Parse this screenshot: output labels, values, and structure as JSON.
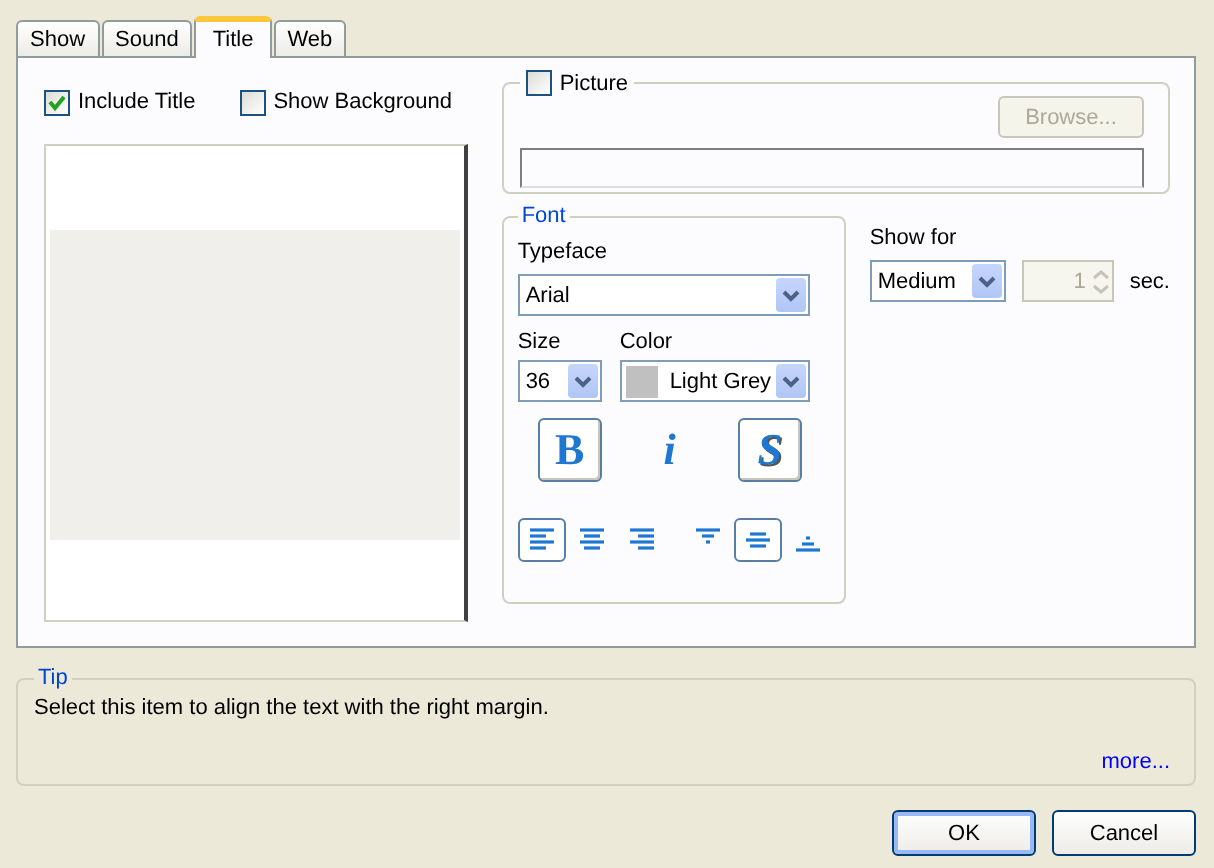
{
  "tabs": [
    {
      "label": "Show",
      "selected": false
    },
    {
      "label": "Sound",
      "selected": false
    },
    {
      "label": "Title",
      "selected": true
    },
    {
      "label": "Web",
      "selected": false
    }
  ],
  "include_title": {
    "label": "Include Title",
    "checked": true
  },
  "show_background": {
    "label": "Show Background",
    "checked": false
  },
  "picture": {
    "label": "Picture",
    "checked": false,
    "browse_button": {
      "label": "Browse...",
      "disabled": true
    }
  },
  "font": {
    "title": "Font",
    "typeface": {
      "label": "Typeface",
      "value": "Arial"
    },
    "size": {
      "label": "Size",
      "value": "36"
    },
    "color": {
      "label": "Color",
      "value": "Light Grey",
      "color": "#c0c0c0"
    },
    "style_buttons": [
      {
        "kind": "bold",
        "label": "B",
        "selected": true
      },
      {
        "kind": "italic",
        "label": "i",
        "selected": false
      },
      {
        "kind": "shadow",
        "label": "S",
        "selected": true
      }
    ],
    "align_buttons": [
      {
        "kind": "left",
        "selected": true
      },
      {
        "kind": "center",
        "selected": false
      },
      {
        "kind": "right",
        "selected": false
      },
      {
        "kind": "top",
        "selected": false
      },
      {
        "kind": "middle",
        "selected": true
      },
      {
        "kind": "bottom",
        "selected": false
      }
    ]
  },
  "show_for": {
    "label": "Show for",
    "value": "Medium",
    "seconds": {
      "value": "1",
      "disabled": true
    },
    "unit": "sec."
  },
  "tip": {
    "title": "Tip",
    "text": "Select this item to align the text with the right margin.",
    "link": "more..."
  },
  "buttons": [
    {
      "label": "OK",
      "default": true
    },
    {
      "label": "Cancel",
      "default": false
    }
  ]
}
